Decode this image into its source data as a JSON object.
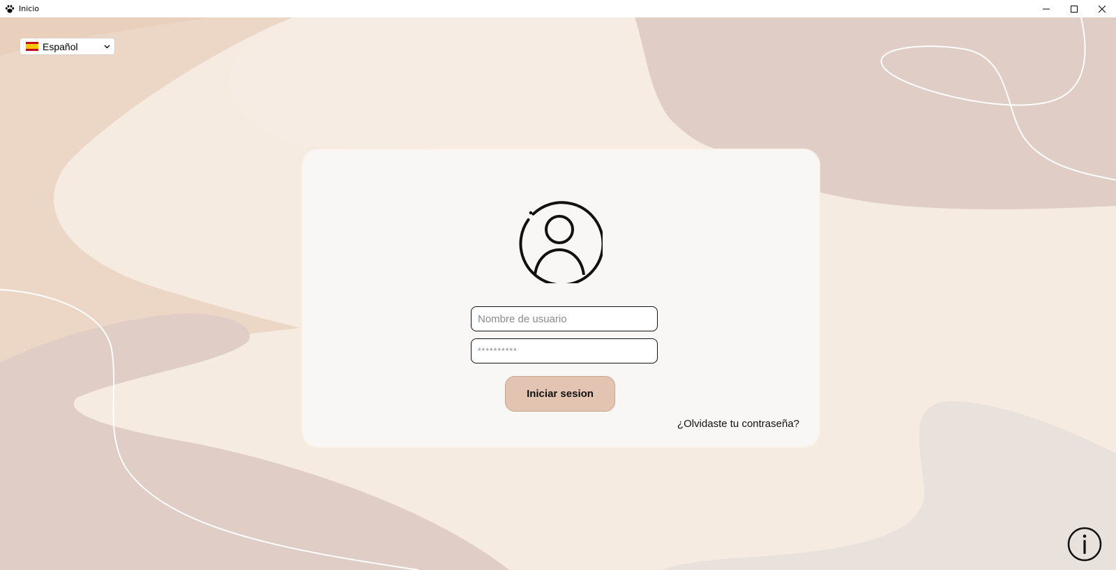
{
  "window": {
    "title": "Inicio",
    "icon": "paw-icon"
  },
  "language": {
    "selected": "Español",
    "flag": "spain-flag-icon"
  },
  "login": {
    "username_placeholder": "Nombre de usuario",
    "password_placeholder": "**********",
    "submit_label": "Iniciar sesion",
    "forgot_label": "¿Olvidaste tu contraseña?"
  },
  "colors": {
    "background": "#f5ebe1",
    "card": "#f9f7f5",
    "button": "#e3c4b2",
    "blob_dark": "#dfcdc6",
    "blob_tan": "#ecd6c6"
  }
}
